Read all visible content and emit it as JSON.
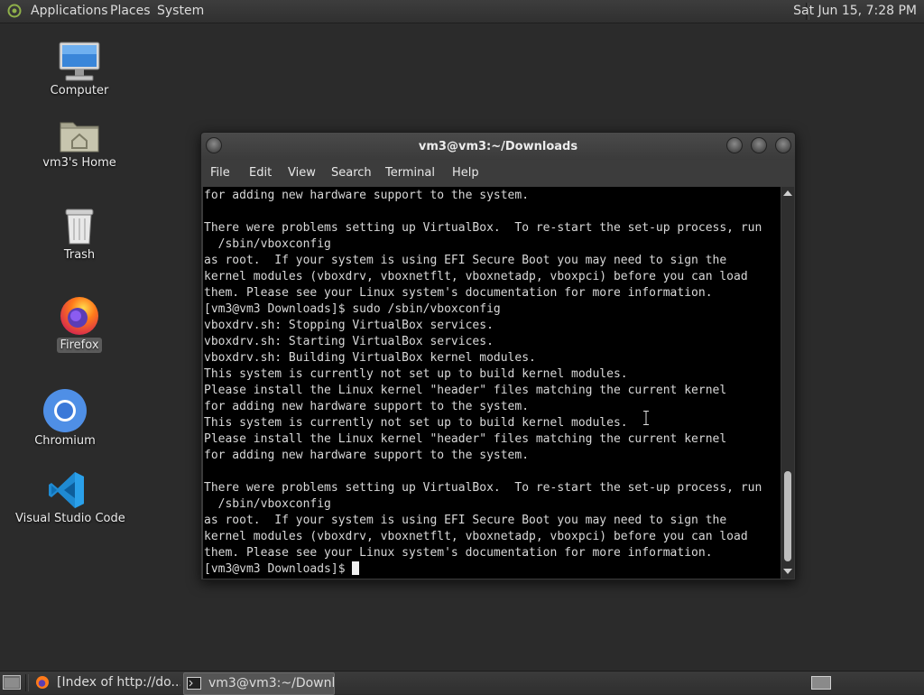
{
  "top_panel": {
    "menus": [
      "Applications",
      "Places",
      "System"
    ],
    "clock": "Sat Jun 15,  7:28 PM"
  },
  "desktop": {
    "icons": [
      {
        "label": "Computer",
        "icon": "computer-icon"
      },
      {
        "label": "vm3's Home",
        "icon": "home-folder-icon"
      },
      {
        "label": "Trash",
        "icon": "trash-icon"
      },
      {
        "label": "Firefox",
        "icon": "firefox-icon"
      },
      {
        "label": "Chromium",
        "icon": "chromium-icon"
      },
      {
        "label": "Visual Studio Code",
        "icon": "vscode-icon"
      }
    ]
  },
  "terminal": {
    "title": "vm3@vm3:~/Downloads",
    "menu": [
      "File",
      "Edit",
      "View",
      "Search",
      "Terminal",
      "Help"
    ],
    "lines": [
      "for adding new hardware support to the system.",
      "",
      "There were problems setting up VirtualBox.  To re-start the set-up process, run",
      "  /sbin/vboxconfig",
      "as root.  If your system is using EFI Secure Boot you may need to sign the",
      "kernel modules (vboxdrv, vboxnetflt, vboxnetadp, vboxpci) before you can load",
      "them. Please see your Linux system's documentation for more information.",
      "[vm3@vm3 Downloads]$ sudo /sbin/vboxconfig",
      "vboxdrv.sh: Stopping VirtualBox services.",
      "vboxdrv.sh: Starting VirtualBox services.",
      "vboxdrv.sh: Building VirtualBox kernel modules.",
      "This system is currently not set up to build kernel modules.",
      "Please install the Linux kernel \"header\" files matching the current kernel",
      "for adding new hardware support to the system.",
      "This system is currently not set up to build kernel modules.",
      "Please install the Linux kernel \"header\" files matching the current kernel",
      "for adding new hardware support to the system.",
      "",
      "There were problems setting up VirtualBox.  To re-start the set-up process, run",
      "  /sbin/vboxconfig",
      "as root.  If your system is using EFI Secure Boot you may need to sign the",
      "kernel modules (vboxdrv, vboxnetflt, vboxnetadp, vboxpci) before you can load",
      "them. Please see your Linux system's documentation for more information."
    ],
    "prompt": "[vm3@vm3 Downloads]$ "
  },
  "taskbar": {
    "tasks": [
      {
        "label": "[Index of http://do...",
        "icon": "firefox-icon",
        "active": false
      },
      {
        "label": "vm3@vm3:~/Downl...",
        "icon": "terminal-icon",
        "active": true
      }
    ]
  }
}
